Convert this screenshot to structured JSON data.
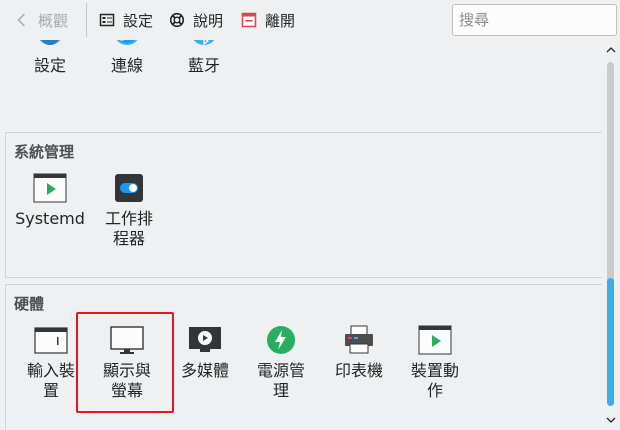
{
  "toolbar": {
    "back_label": "概觀",
    "settings_label": "設定",
    "help_label": "說明",
    "quit_label": "離開",
    "search_placeholder": "搜尋"
  },
  "top_row": {
    "items": [
      {
        "label": "設定",
        "icon": "settings-globe-icon"
      },
      {
        "label": "連線",
        "icon": "network-globe-icon"
      },
      {
        "label": "藍牙",
        "icon": "bluetooth-icon"
      }
    ]
  },
  "system_admin": {
    "title": "系統管理",
    "items": [
      {
        "label": "Systemd",
        "icon": "systemd-window-icon"
      },
      {
        "label": "工作排程器",
        "line1": "工作排",
        "line2": "程器",
        "icon": "task-scheduler-toggle-icon"
      }
    ]
  },
  "hardware": {
    "title": "硬體",
    "items": [
      {
        "line1": "輸入裝",
        "line2": "置",
        "icon": "input-devices-icon"
      },
      {
        "line1": "顯示與",
        "line2": "螢幕",
        "icon": "display-monitor-icon"
      },
      {
        "line1": "多媒體",
        "line2": "",
        "icon": "multimedia-icon"
      },
      {
        "line1": "電源管",
        "line2": "理",
        "icon": "power-management-icon"
      },
      {
        "line1": "印表機",
        "line2": "",
        "icon": "printer-icon"
      },
      {
        "line1": "裝置動",
        "line2": "作",
        "icon": "device-actions-icon"
      }
    ]
  },
  "colors": {
    "accent": "#3daee9",
    "highlight_box": "#e8141c",
    "window_bg": "#eff0f1"
  }
}
